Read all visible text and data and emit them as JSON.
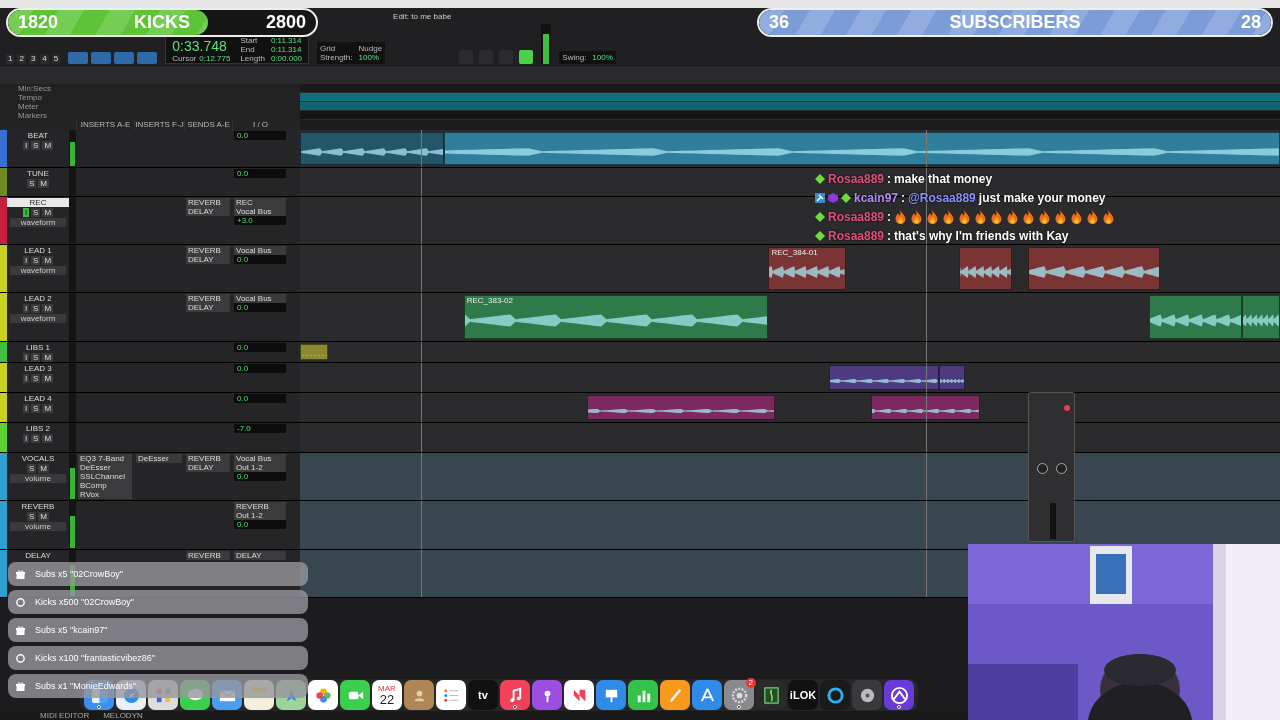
{
  "goal_bars": [
    {
      "label": "KICKS",
      "current": "1820",
      "target": "2800",
      "level": 0.65,
      "color": "#5cc436"
    },
    {
      "label": "SUBSCRIBERS",
      "current": "36",
      "target": "28",
      "level": 1,
      "color": "#7c9cd8"
    }
  ],
  "window": {
    "title": "Edit: to me babe"
  },
  "toolbar": {
    "counter": "0:33.748",
    "cursor_label": "Cursor",
    "cursor_value": "0:12.775",
    "fields": [
      {
        "label": "Start",
        "value": "0:11.314"
      },
      {
        "label": "End",
        "value": "0:11.314"
      },
      {
        "label": "Length",
        "value": "0:00.000"
      }
    ],
    "zoom_presets": [
      "1",
      "2",
      "3",
      "4",
      "5"
    ],
    "grid_label": "Grid",
    "nudge_label": "Nudge",
    "strength_label": "Strength:",
    "strength_value": "100%",
    "swing_label": "Swing:",
    "swing_value": "100%"
  },
  "rulers": [
    "Min:Secs",
    "Tempo",
    "Meter",
    "Markers"
  ],
  "column_headers": [
    "INSERTS A-E",
    "INSERTS F-J",
    "SENDS A-E",
    "I / O"
  ],
  "tracks": [
    {
      "name": "BEAT",
      "color": "#3a6ed0",
      "selected": false,
      "buttons": [
        {
          "label": "I",
          "on": false
        },
        {
          "label": "S",
          "on": false
        },
        {
          "label": "M",
          "on": false
        }
      ],
      "vol": "0.0",
      "clips": [
        {
          "color": "#24566a"
        },
        {
          "color": "#2f7f9c"
        }
      ]
    },
    {
      "name": "TUNE",
      "color": "#6f8c22",
      "selected": false,
      "buttons": [
        {
          "label": "S",
          "on": false
        },
        {
          "label": "M",
          "on": false
        }
      ],
      "vol": "0.0"
    },
    {
      "name": "REC",
      "color": "#c8203c",
      "selected": true,
      "view": "waveform",
      "buttons": [
        {
          "label": "I",
          "on": true
        },
        {
          "label": "S",
          "on": false
        },
        {
          "label": "M",
          "on": false
        }
      ],
      "sends": [
        "REVERB",
        "DELAY"
      ],
      "io": [
        "REC",
        "Vocal Bus"
      ],
      "vol": "+3.0"
    },
    {
      "name": "LEAD 1",
      "color": "#c8d020",
      "selected": false,
      "view": "waveform",
      "buttons": [
        {
          "label": "I",
          "on": false
        },
        {
          "label": "S",
          "on": false
        },
        {
          "label": "M",
          "on": false
        }
      ],
      "sends": [
        "REVERB",
        "DELAY"
      ],
      "io": [
        "Vocal Bus"
      ],
      "vol": "0.0",
      "clips": [
        {
          "label": "REC_384-01",
          "color": "#7a3434"
        },
        {
          "color": "#7a3434"
        },
        {
          "color": "#7a3434"
        }
      ]
    },
    {
      "name": "LEAD 2",
      "color": "#c8d020",
      "selected": false,
      "view": "waveform",
      "buttons": [
        {
          "label": "I",
          "on": false
        },
        {
          "label": "S",
          "on": false
        },
        {
          "label": "M",
          "on": false
        }
      ],
      "sends": [
        "REVERB",
        "DELAY"
      ],
      "io": [
        "Vocal Bus"
      ],
      "vol": "0.0",
      "clips": [
        {
          "label": "REC_383-02",
          "color": "#2f7a4a"
        },
        {
          "color": "#2f7a4a"
        },
        {
          "color": "#2f7a4a"
        }
      ]
    },
    {
      "name": "LIBS 1",
      "color": "#3fc040",
      "selected": false,
      "buttons": [
        {
          "label": "I",
          "on": false
        },
        {
          "label": "S",
          "on": false
        },
        {
          "label": "M",
          "on": false
        }
      ],
      "vol": "0.0",
      "clips": [
        {
          "color": "#8a8a30"
        }
      ]
    },
    {
      "name": "LEAD 3",
      "color": "#c8d020",
      "selected": false,
      "buttons": [
        {
          "label": "I",
          "on": false
        },
        {
          "label": "S",
          "on": false
        },
        {
          "label": "M",
          "on": false
        }
      ],
      "vol": "0.0",
      "clips": [
        {
          "color": "#4e3a7e"
        },
        {
          "color": "#4e3a7e"
        }
      ]
    },
    {
      "name": "LEAD 4",
      "color": "#c8d020",
      "selected": false,
      "buttons": [
        {
          "label": "I",
          "on": false
        },
        {
          "label": "S",
          "on": false
        },
        {
          "label": "M",
          "on": false
        }
      ],
      "vol": "0.0",
      "clips": [
        {
          "color": "#7a2a5c"
        },
        {
          "color": "#7a2a5c"
        }
      ]
    },
    {
      "name": "LIBS 2",
      "color": "#5ed030",
      "selected": false,
      "buttons": [
        {
          "label": "I",
          "on": false
        },
        {
          "label": "S",
          "on": false
        },
        {
          "label": "M",
          "on": false
        }
      ],
      "vol": "-7.0"
    },
    {
      "name": "VOCALS",
      "color": "#2f9fd0",
      "selected": false,
      "view": "volume",
      "buttons": [
        {
          "label": "S",
          "on": false
        },
        {
          "label": "M",
          "on": false
        }
      ],
      "inserts": [
        "EQ3 7-Band",
        "DeEsser",
        "SSLChannel",
        "BComp",
        "RVox"
      ],
      "inserts_2": [
        "DeEsser"
      ],
      "sends": [
        "REVERB",
        "DELAY"
      ],
      "io": [
        "Vocal Bus",
        "Out 1-2"
      ],
      "vol": "0.0"
    },
    {
      "name": "REVERB",
      "color": "#2f9fd0",
      "selected": false,
      "view": "volume",
      "buttons": [
        {
          "label": "S",
          "on": false
        },
        {
          "label": "M",
          "on": false
        }
      ],
      "io": [
        "REVERB",
        "Out 1-2"
      ],
      "vol": "0.0"
    },
    {
      "name": "DELAY",
      "color": "#2f9fd0",
      "selected": false,
      "sends": [
        "REVERB"
      ],
      "io": [
        "DELAY"
      ]
    }
  ],
  "chat": [
    {
      "user": "Rosaa889",
      "color": "#e0507a",
      "badges": [
        {
          "kind": "gem"
        }
      ],
      "separator": ":",
      "segments": [
        {
          "kind": "text",
          "text": "make that money"
        }
      ]
    },
    {
      "user": "kcain97",
      "color": "#b48cf0",
      "badges": [
        {
          "kind": "mod"
        },
        {
          "kind": "sub"
        },
        {
          "kind": "gem"
        }
      ],
      "separator": ":",
      "segments": [
        {
          "kind": "mention",
          "text": "@Rosaa889"
        },
        {
          "kind": "text",
          "text": "just make your money"
        }
      ]
    },
    {
      "user": "Rosaa889",
      "color": "#e0507a",
      "badges": [
        {
          "kind": "gem"
        }
      ],
      "separator": ":",
      "segments": [
        {
          "kind": "emote"
        },
        {
          "kind": "emote"
        },
        {
          "kind": "emote"
        },
        {
          "kind": "emote"
        },
        {
          "kind": "emote"
        },
        {
          "kind": "emote"
        },
        {
          "kind": "emote"
        },
        {
          "kind": "emote"
        },
        {
          "kind": "emote"
        },
        {
          "kind": "emote"
        },
        {
          "kind": "emote"
        },
        {
          "kind": "emote"
        },
        {
          "kind": "emote"
        },
        {
          "kind": "emote"
        }
      ]
    },
    {
      "user": "Rosaa889",
      "color": "#e0507a",
      "badges": [
        {
          "kind": "gem"
        }
      ],
      "separator": ":",
      "segments": [
        {
          "kind": "text",
          "text": "that's why I'm friends with Kay"
        }
      ]
    }
  ],
  "alerts": [
    {
      "kind": "sub",
      "text": "Subs x5 \"02CrowBoy\""
    },
    {
      "kind": "kick",
      "text": "Kicks x500 \"02CrowBoy\""
    },
    {
      "kind": "sub",
      "text": "Subs x5 \"kcain97\""
    },
    {
      "kind": "kick",
      "text": "Kicks x100 \"frantasticvibez86\""
    },
    {
      "kind": "sub",
      "text": "Subs x1 \"MonieEdwards\""
    }
  ],
  "bottom_tabs": [
    "MIDI EDITOR",
    "MELODYN"
  ],
  "dock": [
    {
      "kind": "finder",
      "running": true
    },
    {
      "kind": "safari",
      "running": false
    },
    {
      "kind": "launchpad",
      "running": false
    },
    {
      "kind": "messages",
      "running": false
    },
    {
      "kind": "mail",
      "running": false
    },
    {
      "kind": "notes",
      "running": false
    },
    {
      "kind": "maps",
      "running": false
    },
    {
      "kind": "photos",
      "running": false
    },
    {
      "kind": "facetime",
      "running": false
    },
    {
      "kind": "calendar",
      "month": "MAR",
      "day": "22",
      "running": false
    },
    {
      "kind": "contacts",
      "running": false
    },
    {
      "kind": "reminders",
      "running": false
    },
    {
      "kind": "tv",
      "label": "tv",
      "running": false
    },
    {
      "kind": "music",
      "running": true
    },
    {
      "kind": "podcasts",
      "running": false
    },
    {
      "kind": "news",
      "running": false
    },
    {
      "kind": "keynote",
      "running": false
    },
    {
      "kind": "numbers",
      "running": false
    },
    {
      "kind": "pages",
      "running": false
    },
    {
      "kind": "appstore",
      "running": false
    },
    {
      "kind": "settings",
      "badge": "2",
      "running": true
    },
    {
      "kind": "notation",
      "running": false
    },
    {
      "kind": "ilok",
      "label": "iLOK",
      "running": false
    },
    {
      "kind": "ring",
      "running": false
    },
    {
      "kind": "disk",
      "running": false
    },
    {
      "kind": "protools",
      "running": true
    }
  ],
  "webcam": {
    "kind": "picture"
  }
}
